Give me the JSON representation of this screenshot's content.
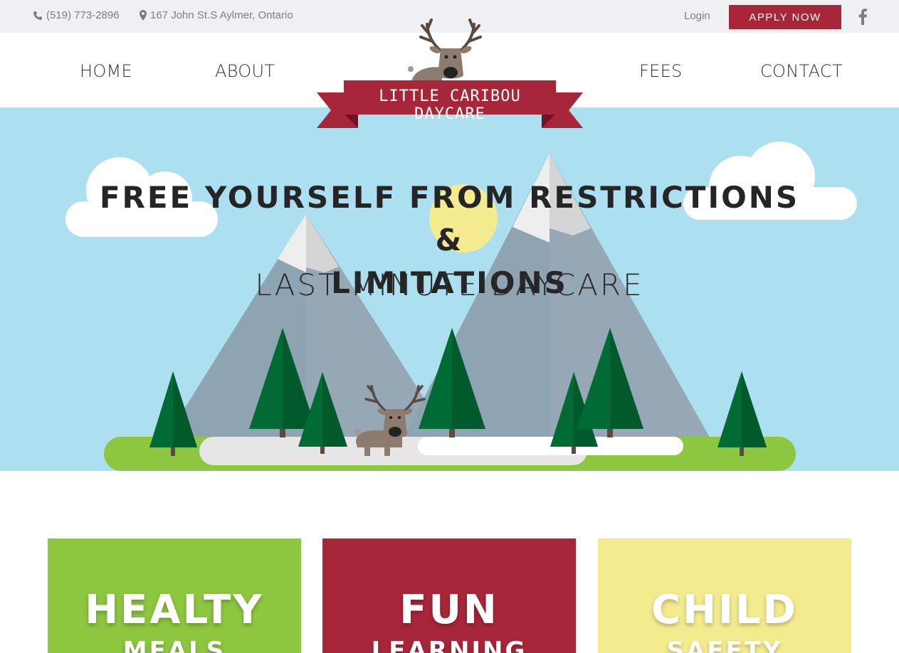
{
  "topbar": {
    "phone": "(519) 773-2896",
    "address": "167 John St.S Aylmer, Ontario",
    "login_label": "Login",
    "apply_label": "APPLY NOW",
    "phone_icon": "phone-icon",
    "location_icon": "map-marker-icon",
    "social_icon": "facebook-icon"
  },
  "nav": {
    "items": [
      {
        "label": "HOME"
      },
      {
        "label": "ABOUT"
      },
      {
        "label": "FEES"
      },
      {
        "label": "CONTACT"
      }
    ]
  },
  "logo": {
    "text": "LITTLE CARIBOU DAYCARE"
  },
  "hero": {
    "headline_line1": "FREE YOURSELF FROM RESTRICTIONS &",
    "headline_line2": "LIMITATIONS",
    "subheadline": "LAST MINUTE DAYCARE"
  },
  "features": [
    {
      "title": "HEALTY",
      "subtitle": "MEALS"
    },
    {
      "title": "FUN",
      "subtitle": "LEARNING"
    },
    {
      "title": "CHILD",
      "subtitle": "SAFETY"
    }
  ],
  "colors": {
    "brand_red": "#a8263a",
    "sky_blue": "#acdff0",
    "grass_green": "#8dc63f",
    "sun_yellow": "#f4ea8e",
    "tree_green": "#006b35"
  }
}
